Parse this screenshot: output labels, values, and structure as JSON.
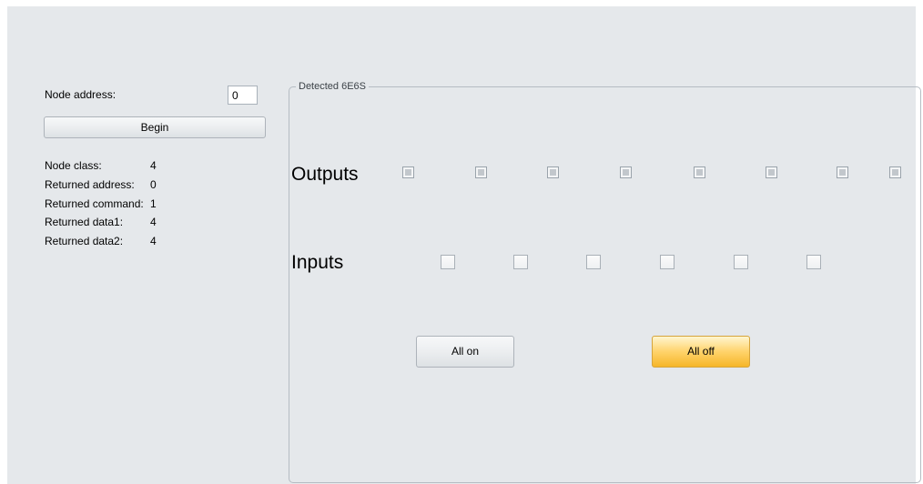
{
  "controls": {
    "node_address_label": "Node address:",
    "node_address_value": "0",
    "begin_label": "Begin"
  },
  "info": [
    {
      "label": "Node class:",
      "value": "4"
    },
    {
      "label": "Returned address:",
      "value": "0"
    },
    {
      "label": "Returned command:",
      "value": "1"
    },
    {
      "label": "Returned data1:",
      "value": "4"
    },
    {
      "label": "Returned data2:",
      "value": "4"
    }
  ],
  "device": {
    "group_title": "Detected 6E6S",
    "outputs_label": "Outputs",
    "inputs_label": "Inputs",
    "outputs_count": 8,
    "inputs_count": 6,
    "all_on_label": "All on",
    "all_off_label": "All off",
    "all_off_highlight": "#ffd36b"
  }
}
